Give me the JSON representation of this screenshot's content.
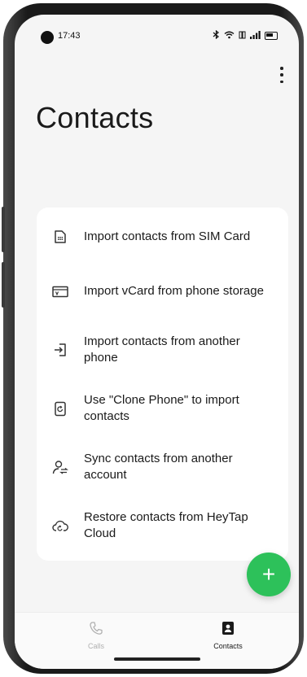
{
  "status_bar": {
    "time": "17:43",
    "icons": [
      "bluetooth-icon",
      "wifi-icon",
      "network-icon",
      "signal-icon",
      "battery-icon"
    ]
  },
  "header": {
    "title": "Contacts",
    "menu_icon": "more-vert-icon"
  },
  "import_options": [
    {
      "label": "Import contacts from SIM Card",
      "icon": "sim-card-icon"
    },
    {
      "label": "Import vCard from phone storage",
      "icon": "vcard-icon"
    },
    {
      "label": "Import contacts from another phone",
      "icon": "import-icon"
    },
    {
      "label": "Use \"Clone Phone\" to import contacts",
      "icon": "clone-phone-icon"
    },
    {
      "label": "Sync contacts from another account",
      "icon": "sync-account-icon"
    },
    {
      "label": "Restore contacts from HeyTap Cloud",
      "icon": "cloud-restore-icon"
    }
  ],
  "fab": {
    "label": "+",
    "icon": "add-icon",
    "color": "#2dc15a"
  },
  "bottom_nav": {
    "tabs": [
      {
        "label": "Calls",
        "icon": "phone-icon",
        "active": false
      },
      {
        "label": "Contacts",
        "icon": "contacts-icon",
        "active": true
      }
    ]
  },
  "colors": {
    "accent": "#2dc15a",
    "background": "#f5f5f5",
    "card": "#ffffff",
    "text": "#1a1a1a",
    "inactive": "#b0b0b0"
  }
}
